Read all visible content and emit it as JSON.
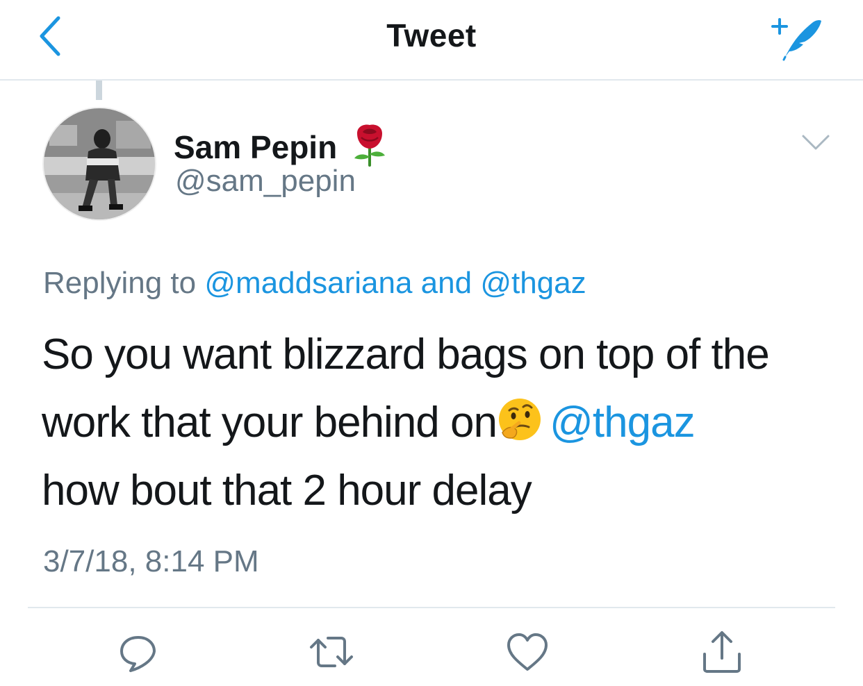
{
  "navbar": {
    "title": "Tweet",
    "back_icon": "chevron-left-icon",
    "compose_icon": "compose-tweet-icon"
  },
  "tweet": {
    "author": {
      "display_name": "Sam Pepin",
      "name_emoji": "rose-emoji",
      "handle": "@sam_pepin"
    },
    "replying_to": {
      "prefix": "Replying to",
      "user1": "@maddsariana",
      "conjunction": "and",
      "user2": "@thgaz"
    },
    "text": {
      "line1": "So you want blizzard bags on top of the",
      "line2": "work that your behind on",
      "emoji": "thinking-face-emoji",
      "mention": "@thgaz",
      "line3": "how bout that 2 hour delay"
    },
    "timestamp": "3/7/18, 8:14 PM"
  },
  "actions": [
    "reply-icon",
    "retweet-icon",
    "like-icon",
    "share-icon"
  ],
  "colors": {
    "accent": "#1b95e0",
    "text": "#14171a",
    "secondary": "#657786",
    "divider": "#e1e8ed"
  }
}
